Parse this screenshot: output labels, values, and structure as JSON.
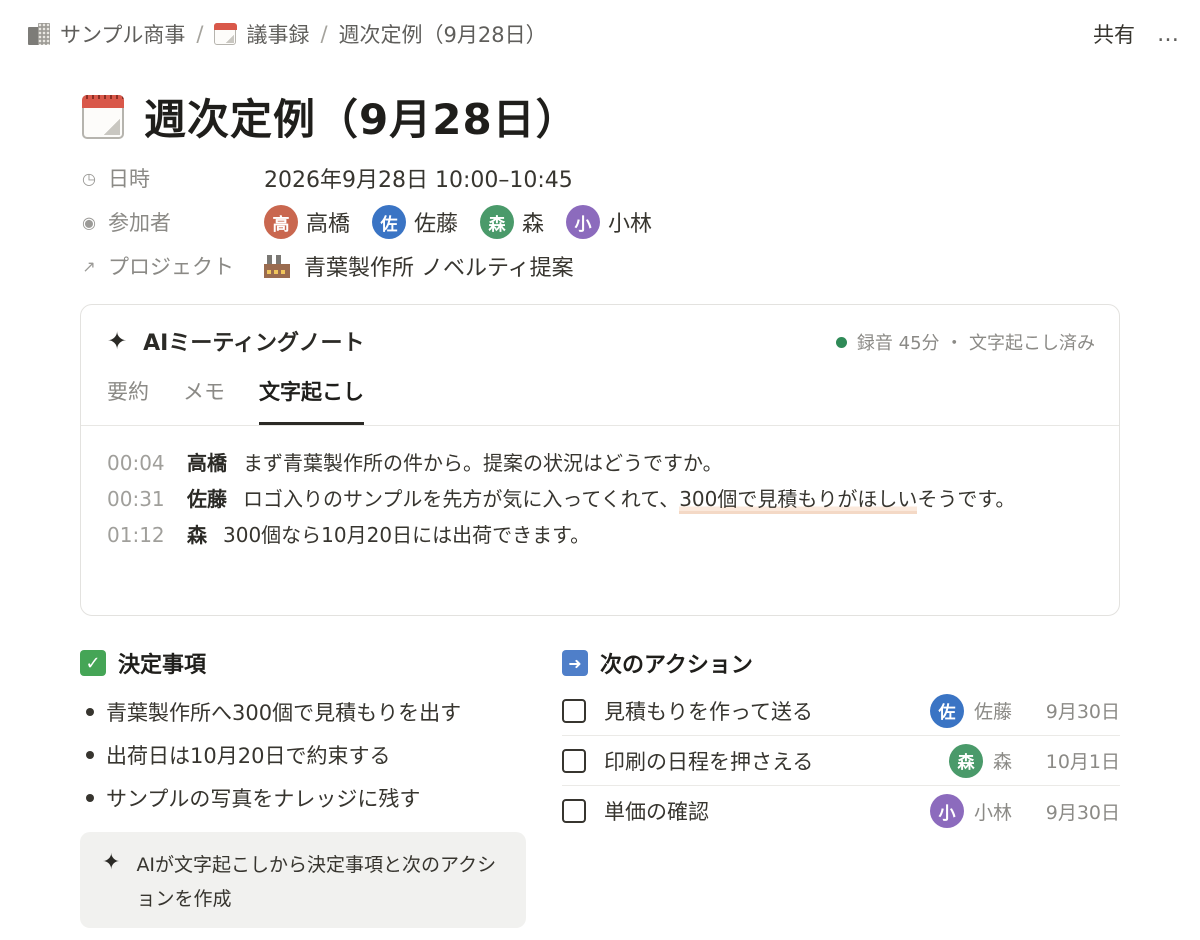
{
  "breadcrumb": {
    "workspace": "サンプル商事",
    "section": "議事録",
    "page": "週次定例（9月28日）"
  },
  "topbar": {
    "share_label": "共有",
    "more_label": "…"
  },
  "page": {
    "title": "週次定例（9月28日）"
  },
  "properties": {
    "datetime": {
      "label": "日時",
      "value": "2026年9月28日 10:00–10:45"
    },
    "participants": {
      "label": "参加者",
      "people": [
        {
          "initial": "高",
          "name": "高橋",
          "color": "#c9674f"
        },
        {
          "initial": "佐",
          "name": "佐藤",
          "color": "#3a74c4"
        },
        {
          "initial": "森",
          "name": "森",
          "color": "#4a9a6a"
        },
        {
          "initial": "小",
          "name": "小林",
          "color": "#8c6bbd"
        }
      ]
    },
    "project": {
      "label": "プロジェクト",
      "value": "青葉製作所 ノベルティ提案"
    }
  },
  "ai_notes": {
    "title": "AIミーティングノート",
    "status": "録音 45分 ・ 文字起こし済み",
    "status_color": "#2f8a57",
    "tabs": [
      "要約",
      "メモ",
      "文字起こし"
    ],
    "active_tab": "文字起こし",
    "transcript": [
      {
        "time": "00:04",
        "speaker": "高橋",
        "text": "まず青葉製作所の件から。提案の状況はどうですか。"
      },
      {
        "time": "00:31",
        "speaker": "佐藤",
        "text_before": "ロゴ入りのサンプルを先方が気に入ってくれて、",
        "highlight": "300個で見積もりがほしい",
        "text_after": "そうです。"
      },
      {
        "time": "01:12",
        "speaker": "森",
        "text": "300個なら10月20日には出荷できます。"
      }
    ]
  },
  "decisions": {
    "heading": "決定事項",
    "items": [
      "青葉製作所へ300個で見積もりを出す",
      "出荷日は10月20日で約束する",
      "サンプルの写真をナレッジに残す"
    ],
    "ai_note": "AIが文字起こしから決定事項と次のアクションを作成"
  },
  "actions": {
    "heading": "次のアクション",
    "tasks": [
      {
        "label": "見積もりを作って送る",
        "initial": "佐",
        "assignee": "佐藤",
        "color": "#3a74c4",
        "due": "9月30日"
      },
      {
        "label": "印刷の日程を押さえる",
        "initial": "森",
        "assignee": "森",
        "color": "#4a9a6a",
        "due": "10月1日"
      },
      {
        "label": "単価の確認",
        "initial": "小",
        "assignee": "小林",
        "color": "#8c6bbd",
        "due": "9月30日"
      }
    ]
  }
}
